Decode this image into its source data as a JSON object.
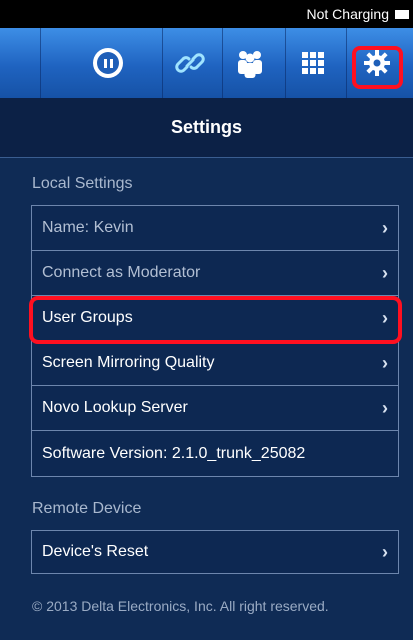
{
  "status_bar": {
    "text": "Not Charging"
  },
  "toolbar": {
    "buttons": [
      {
        "name": "pause-icon"
      },
      {
        "name": "link-icon"
      },
      {
        "name": "users-icon"
      },
      {
        "name": "grid-icon"
      },
      {
        "name": "gear-icon"
      }
    ],
    "highlight_color": "#ff1020"
  },
  "page": {
    "title": "Settings"
  },
  "local_settings": {
    "header": "Local Settings",
    "items": [
      {
        "label": "Name: Kevin",
        "chevron": "›"
      },
      {
        "label": "Connect as Moderator",
        "chevron": "›"
      },
      {
        "label": "User Groups",
        "chevron": "›"
      },
      {
        "label": "Screen Mirroring Quality",
        "chevron": "›"
      },
      {
        "label": "Novo Lookup Server",
        "chevron": "›"
      },
      {
        "label": "Software Version: 2.1.0_trunk_25082"
      }
    ]
  },
  "remote_device": {
    "header": "Remote Device",
    "items": [
      {
        "label": "Device's Reset",
        "chevron": "›"
      }
    ]
  },
  "footer": {
    "text": "© 2013 Delta Electronics, Inc. All right reserved."
  }
}
